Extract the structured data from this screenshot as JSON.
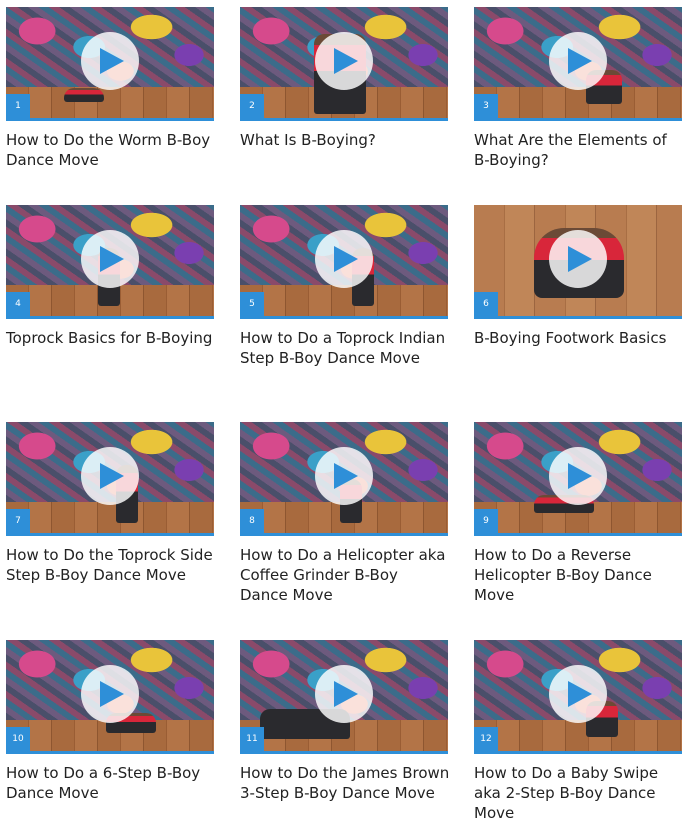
{
  "videos": [
    {
      "num": "1",
      "title": "How to Do the Worm B-Boy Dance Move"
    },
    {
      "num": "2",
      "title": "What Is B-Boying?"
    },
    {
      "num": "3",
      "title": "What Are the Elements of B-Boying?"
    },
    {
      "num": "4",
      "title": "Toprock Basics for B-Boying"
    },
    {
      "num": "5",
      "title": "How to Do a Toprock Indian Step B-Boy Dance Move"
    },
    {
      "num": "6",
      "title": "B-Boying Footwork Basics"
    },
    {
      "num": "7",
      "title": "How to Do the Toprock Side Step B-Boy Dance Move"
    },
    {
      "num": "8",
      "title": "How to Do a Helicopter aka Coffee Grinder B-Boy Dance Move"
    },
    {
      "num": "9",
      "title": "How to Do a Reverse Helicopter B-Boy Dance Move"
    },
    {
      "num": "10",
      "title": "How to Do a 6-Step B-Boy Dance Move"
    },
    {
      "num": "11",
      "title": "How to Do the James Brown 3-Step B-Boy Dance Move"
    },
    {
      "num": "12",
      "title": "How to Do a Baby Swipe aka 2-Step B-Boy Dance Move"
    }
  ],
  "colors": {
    "accent": "#2e8fd8",
    "play_overlay": "#ffffff",
    "play_arrow": "#2e8fd8"
  },
  "icons": {
    "play": "play-icon"
  }
}
